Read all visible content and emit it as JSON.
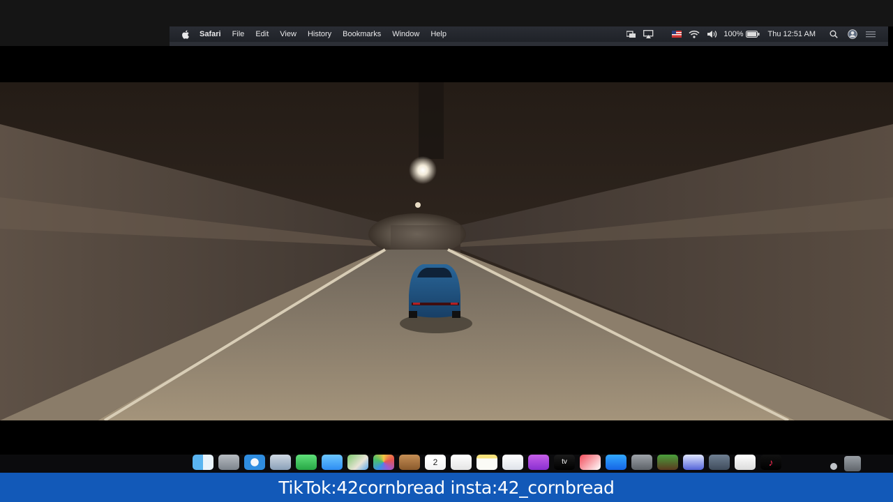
{
  "menubar": {
    "app_name": "Safari",
    "items": [
      "File",
      "Edit",
      "View",
      "History",
      "Bookmarks",
      "Window",
      "Help"
    ],
    "battery": "100%",
    "clock": "Thu 12:51 AM",
    "status_icons": [
      "display-icon",
      "airplay-icon",
      "flag-icon",
      "wifi-icon",
      "volume-icon",
      "battery-icon",
      "spotlight-icon",
      "user-icon",
      "control-center-icon"
    ]
  },
  "video": {
    "scene": "car-in-tunnel"
  },
  "dock": {
    "apps": [
      "finder",
      "launchpad",
      "safari",
      "mail-photo",
      "facetime",
      "messages",
      "maps",
      "photos",
      "contacts",
      "calendar",
      "reminders",
      "notes",
      "music",
      "podcasts",
      "tv",
      "news",
      "app-store",
      "system-preferences",
      "minecraft",
      "roblox",
      "screenshot",
      "capcut",
      "tiktok"
    ],
    "calendar_day": "2"
  },
  "caption": {
    "text": "TikTok:42cornbread insta:42_cornbread"
  },
  "colors": {
    "caption_bg": "#1259b8",
    "menubar_bg": "#23262c",
    "car": "#1e4f80"
  }
}
